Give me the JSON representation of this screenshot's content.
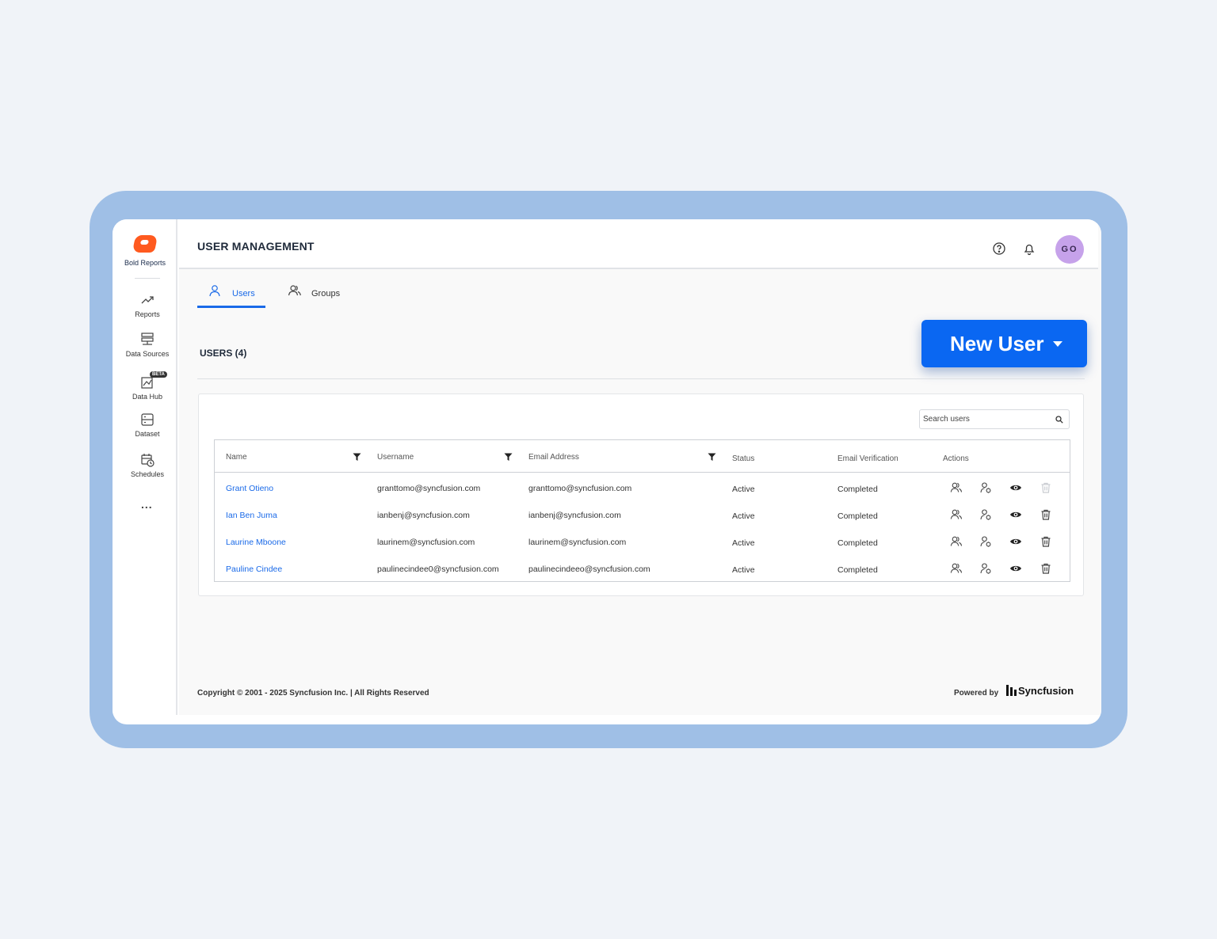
{
  "app": {
    "name": "Bold Reports"
  },
  "sidebar": {
    "items": [
      {
        "label": "Reports",
        "icon": "trending-up-icon"
      },
      {
        "label": "Data Sources",
        "icon": "database-icon"
      },
      {
        "label": "Data Hub",
        "icon": "data-hub-icon",
        "badge": "BETA"
      },
      {
        "label": "Dataset",
        "icon": "dataset-icon"
      },
      {
        "label": "Schedules",
        "icon": "calendar-clock-icon"
      }
    ],
    "more": "..."
  },
  "header": {
    "title": "USER MANAGEMENT",
    "avatar_initials": "GO",
    "avatar_color": "#c6a2ea"
  },
  "tabs": [
    {
      "label": "Users",
      "icon": "user-icon",
      "active": true
    },
    {
      "label": "Groups",
      "icon": "users-group-icon",
      "active": false
    }
  ],
  "users_section": {
    "count_label": "USERS (4)",
    "new_user_label": "New User",
    "accent_color": "#0a67f2"
  },
  "search": {
    "placeholder": "Search users"
  },
  "table": {
    "columns": [
      "Name",
      "Username",
      "Email Address",
      "Status",
      "Email Verification",
      "Actions"
    ],
    "rows": [
      {
        "name": "Grant Otieno",
        "username": "granttomo@syncfusion.com",
        "email": "granttomo@syncfusion.com",
        "status": "Active",
        "verification": "Completed",
        "delete_disabled": true
      },
      {
        "name": "Ian Ben Juma",
        "username": "ianbenj@syncfusion.com",
        "email": "ianbenj@syncfusion.com",
        "status": "Active",
        "verification": "Completed",
        "delete_disabled": false
      },
      {
        "name": "Laurine Mboone",
        "username": "laurinem@syncfusion.com",
        "email": "laurinem@syncfusion.com",
        "status": "Active",
        "verification": "Completed",
        "delete_disabled": false
      },
      {
        "name": "Pauline Cindee",
        "username": "paulinecindee0@syncfusion.com",
        "email": "paulinecindeeo@syncfusion.com",
        "status": "Active",
        "verification": "Completed",
        "delete_disabled": false
      }
    ],
    "action_icons": [
      "manage-groups-icon",
      "user-permissions-icon",
      "view-icon",
      "delete-icon"
    ]
  },
  "footer": {
    "copyright": "Copyright © 2001 - 2025 Syncfusion Inc.  |  All Rights Reserved",
    "powered_by": "Powered by",
    "brand": "Syncfusion"
  }
}
